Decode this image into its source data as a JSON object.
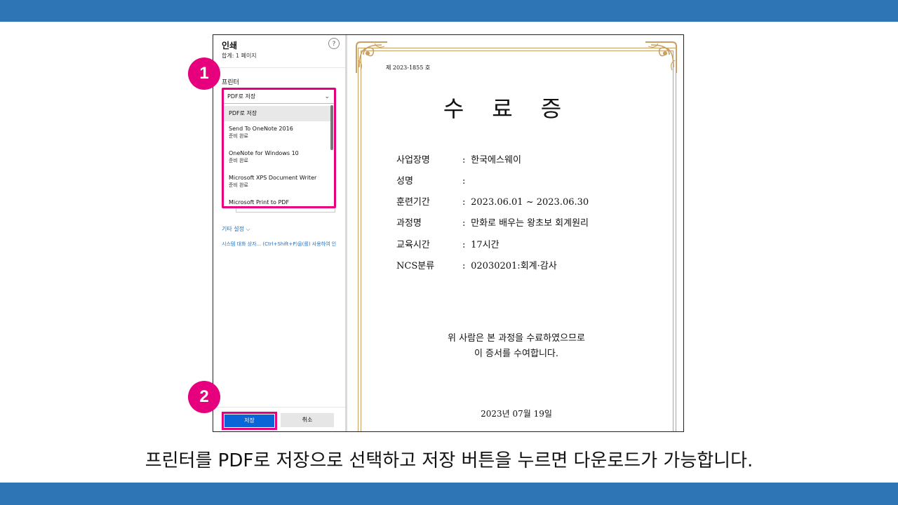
{
  "colors": {
    "banner": "#2e75b6",
    "highlight": "#e6007e",
    "primary_button": "#0a66d6",
    "certificate_frame": "#c9a064"
  },
  "print_panel": {
    "title": "인쇄",
    "subtitle": "합계: 1 페이지",
    "help_icon": "help-icon",
    "printer_label": "프린터",
    "selected_printer": "PDF로 저장",
    "printer_options": [
      {
        "name": "PDF로 저장",
        "status": ""
      },
      {
        "name": "Send To OneNote 2016",
        "status": "준비 완료"
      },
      {
        "name": "OneNote for Windows 10",
        "status": "준비 완료"
      },
      {
        "name": "Microsoft XPS Document Writer",
        "status": "준비 완료"
      },
      {
        "name": "Microsoft Print to PDF",
        "status": ""
      }
    ],
    "more_settings": "기타 설정 ⌵",
    "system_dialog_link": "시스템 대화 상자... (Ctrl+Shift+P)을(를) 사용하여 인",
    "save_button": "저장",
    "cancel_button": "취소"
  },
  "certificate": {
    "number": "제  2023-1855  호",
    "title": "수료증",
    "fields": [
      {
        "label": "사업장명",
        "value": "한국에스웨이"
      },
      {
        "label": "성명",
        "value": ""
      },
      {
        "label": "훈련기간",
        "value": "2023.06.01 ~ 2023.06.30"
      },
      {
        "label": "과정명",
        "value": "만화로 배우는 왕초보 회계원리"
      },
      {
        "label": "교육시간",
        "value": "17시간"
      },
      {
        "label": "NCS분류",
        "value": "02030201:회계·감사"
      }
    ],
    "closing_line1": "위 사람은 본 과정을 수료하였으므로",
    "closing_line2": "이 증서를 수여합니다.",
    "date": "2023년   07월   19일"
  },
  "steps": {
    "step1": "1",
    "step2": "2"
  },
  "caption": "프린터를 PDF로 저장으로 선택하고 저장 버튼을 누르면 다운로드가 가능합니다."
}
